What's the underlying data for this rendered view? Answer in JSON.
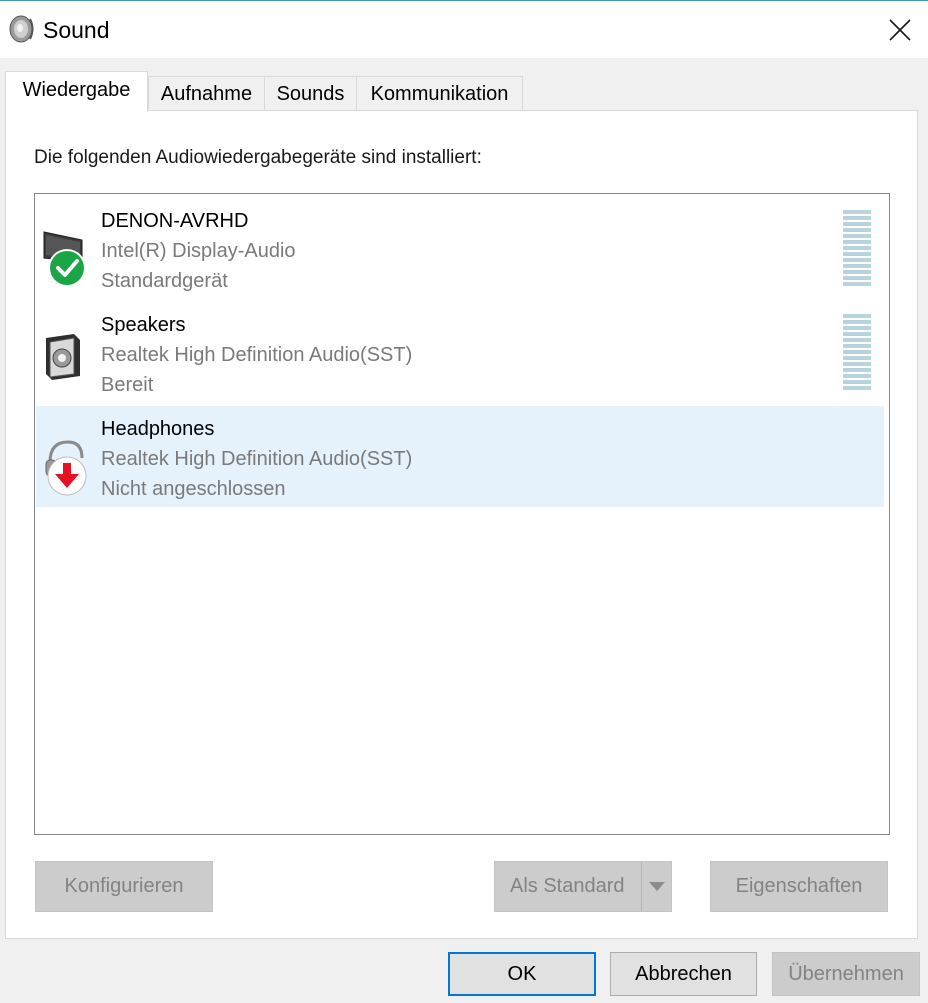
{
  "window": {
    "title": "Sound",
    "close_label": "close"
  },
  "tabs": [
    {
      "label": "Wiedergabe",
      "active": true
    },
    {
      "label": "Aufnahme",
      "active": false
    },
    {
      "label": "Sounds",
      "active": false
    },
    {
      "label": "Kommunikation",
      "active": false
    }
  ],
  "panel": {
    "intro": "Die folgenden Audiowiedergabegeräte sind installiert:",
    "devices": [
      {
        "name": "DENON-AVRHD",
        "driver": "Intel(R) Display-Audio",
        "status": "Standardgerät",
        "icon": "monitor-icon",
        "badge": "default-check-icon",
        "selected": false,
        "level": 0
      },
      {
        "name": "Speakers",
        "driver": "Realtek High Definition Audio(SST)",
        "status": "Bereit",
        "icon": "speaker-icon",
        "badge": "",
        "selected": false,
        "level": 0
      },
      {
        "name": "Headphones",
        "driver": "Realtek High Definition Audio(SST)",
        "status": "Nicht angeschlossen",
        "icon": "headphones-icon",
        "badge": "unplugged-arrow-icon",
        "selected": true
      }
    ],
    "buttons": {
      "configure": "Konfigurieren",
      "set_default": "Als Standard",
      "properties": "Eigenschaften"
    }
  },
  "dialog_buttons": {
    "ok": "OK",
    "cancel": "Abbrechen",
    "apply": "Übernehmen"
  },
  "colors": {
    "selection": "#e5f1fb",
    "ok_border": "#0078d7",
    "default_check": "#1aa547",
    "unplugged_arrow": "#e81123"
  }
}
